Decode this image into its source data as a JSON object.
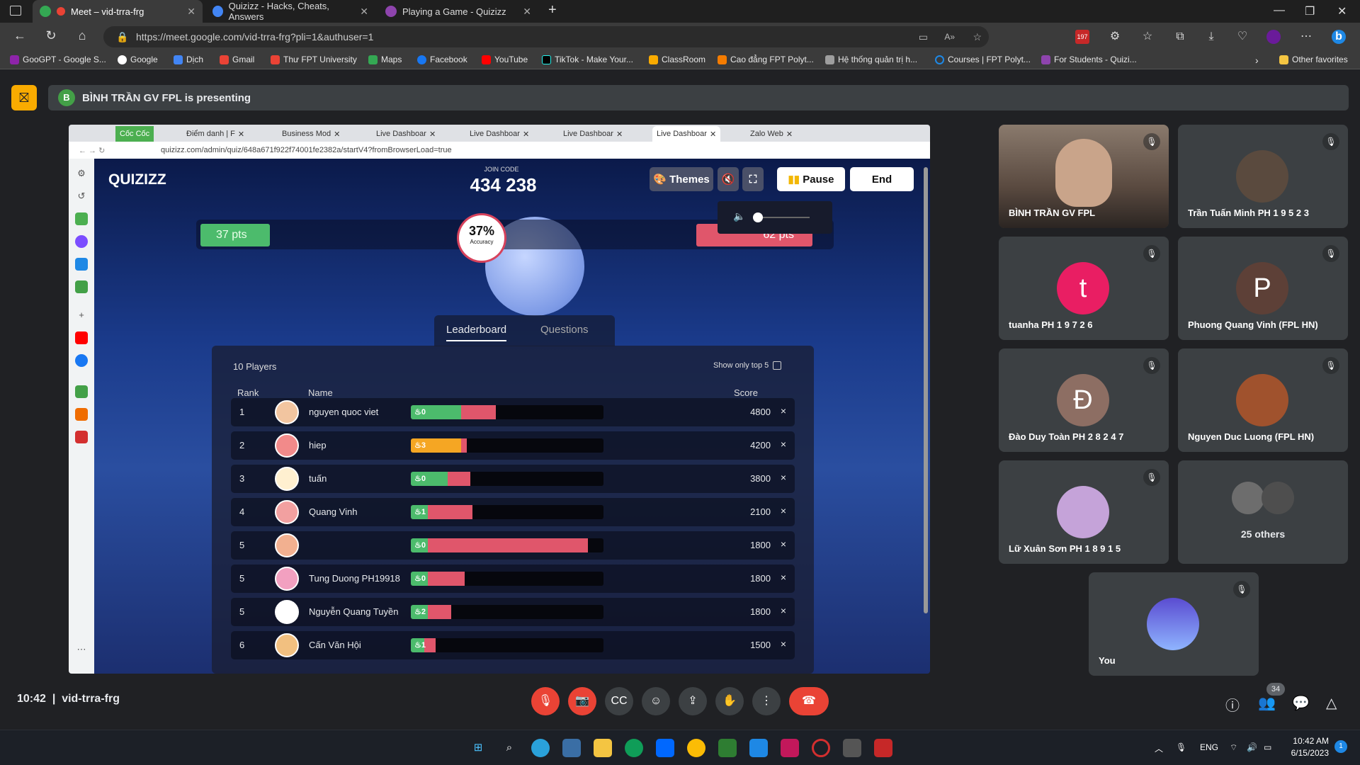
{
  "browser": {
    "tabs": [
      {
        "title": "Meet – vid-trra-frg",
        "active": true
      },
      {
        "title": "Quizizz - Hacks, Cheats, Answers",
        "active": false
      },
      {
        "title": "Playing a Game - Quizizz",
        "active": false
      }
    ],
    "url": "https://meet.google.com/vid-trra-frg?pli=1&authuser=1",
    "badge_count": "197",
    "bookmarks": [
      "GooGPT - Google S...",
      "Google",
      "Dịch",
      "Gmail",
      "Thư FPT University",
      "Maps",
      "Facebook",
      "YouTube",
      "TikTok - Make Your...",
      "ClassRoom",
      "Cao đẳng FPT Polyt...",
      "Hệ thống quản trị h...",
      "Courses | FPT Polyt...",
      "For Students - Quizi..."
    ],
    "other_favorites": "Other favorites"
  },
  "meet": {
    "presenting_text": "BÌNH TRẦN GV FPL is presenting",
    "presenter_initial": "B",
    "time": "10:42",
    "meeting_code": "vid-trra-frg",
    "participants_badge": "34",
    "tiles": [
      {
        "name": "BÌNH TRẦN GV FPL",
        "initial": "",
        "color": "#6a5a50"
      },
      {
        "name": "Trần Tuấn Minh PH 1 9 5 2 3",
        "initial": "",
        "color": "#3c4043"
      },
      {
        "name": "tuanha PH 1 9 7 2 6",
        "initial": "t",
        "color": "#e91e63"
      },
      {
        "name": "Phuong Quang Vinh (FPL HN)",
        "initial": "P",
        "color": "#5d4037"
      },
      {
        "name": "Đào Duy Toàn PH 2 8 2 4 7",
        "initial": "Đ",
        "color": "#795548"
      },
      {
        "name": "Nguyen Duc Luong (FPL HN)",
        "initial": "",
        "color": "#3c4043"
      },
      {
        "name": "Lữ Xuân Sơn PH 1 8 9 1 5",
        "initial": "",
        "color": "#3c4043"
      },
      {
        "name": "25 others",
        "initial": "",
        "color": "#3c4043"
      },
      {
        "name": "You",
        "initial": "",
        "color": "#3c4043"
      }
    ]
  },
  "shared": {
    "tabs": [
      "Cốc Cốc",
      "Điểm danh | F",
      "Business Mod",
      "Live Dashboar",
      "Live Dashboar",
      "Live Dashboar",
      "Live Dashboar",
      "Zalo Web"
    ],
    "url": "quizizz.com/admin/quiz/648a671f922f74001fe2382a/startV4?fromBrowserLoad=true",
    "quiz": {
      "logo": "QUIZIZZ",
      "join_label": "JOIN CODE",
      "join_code": "434 238",
      "themes": "Themes",
      "pause": "Pause",
      "end": "End",
      "left_pts": "37 pts",
      "right_pts": "62 pts",
      "accuracy": "37%",
      "accuracy_label": "Accuracy",
      "tab_leaderboard": "Leaderboard",
      "tab_questions": "Questions",
      "players": "10 Players",
      "show_top": "Show only top 5",
      "col_rank": "Rank",
      "col_name": "Name",
      "col_score": "Score",
      "rows": [
        {
          "rank": "1",
          "name": "nguyen quoc viet",
          "streak": "0",
          "green": 0.26,
          "red": 0.18,
          "score": "4800"
        },
        {
          "rank": "2",
          "name": "hiep",
          "streak": "3",
          "green": 0.0,
          "red": 0.0,
          "orange": 0.26,
          "score": "4200"
        },
        {
          "rank": "3",
          "name": "tuấn",
          "streak": "0",
          "green": 0.19,
          "red": 0.12,
          "score": "3800"
        },
        {
          "rank": "4",
          "name": "Quang Vinh",
          "streak": "1",
          "green": 0.09,
          "red": 0.23,
          "score": "2100"
        },
        {
          "rank": "5",
          "name": "",
          "streak": "0",
          "green": 0.09,
          "red": 0.83,
          "score": "1800"
        },
        {
          "rank": "5",
          "name": "Tung Duong PH19918",
          "streak": "0",
          "green": 0.09,
          "red": 0.19,
          "score": "1800"
        },
        {
          "rank": "5",
          "name": "Nguyễn Quang Tuyền",
          "streak": "2",
          "green": 0.09,
          "red": 0.12,
          "score": "1800"
        },
        {
          "rank": "6",
          "name": "Cấn Văn Hội",
          "streak": "1",
          "green": 0.07,
          "red": 0.06,
          "score": "1500"
        }
      ]
    }
  },
  "taskbar": {
    "lang": "ENG",
    "time": "10:42 AM",
    "date": "6/15/2023",
    "notif": "1"
  }
}
